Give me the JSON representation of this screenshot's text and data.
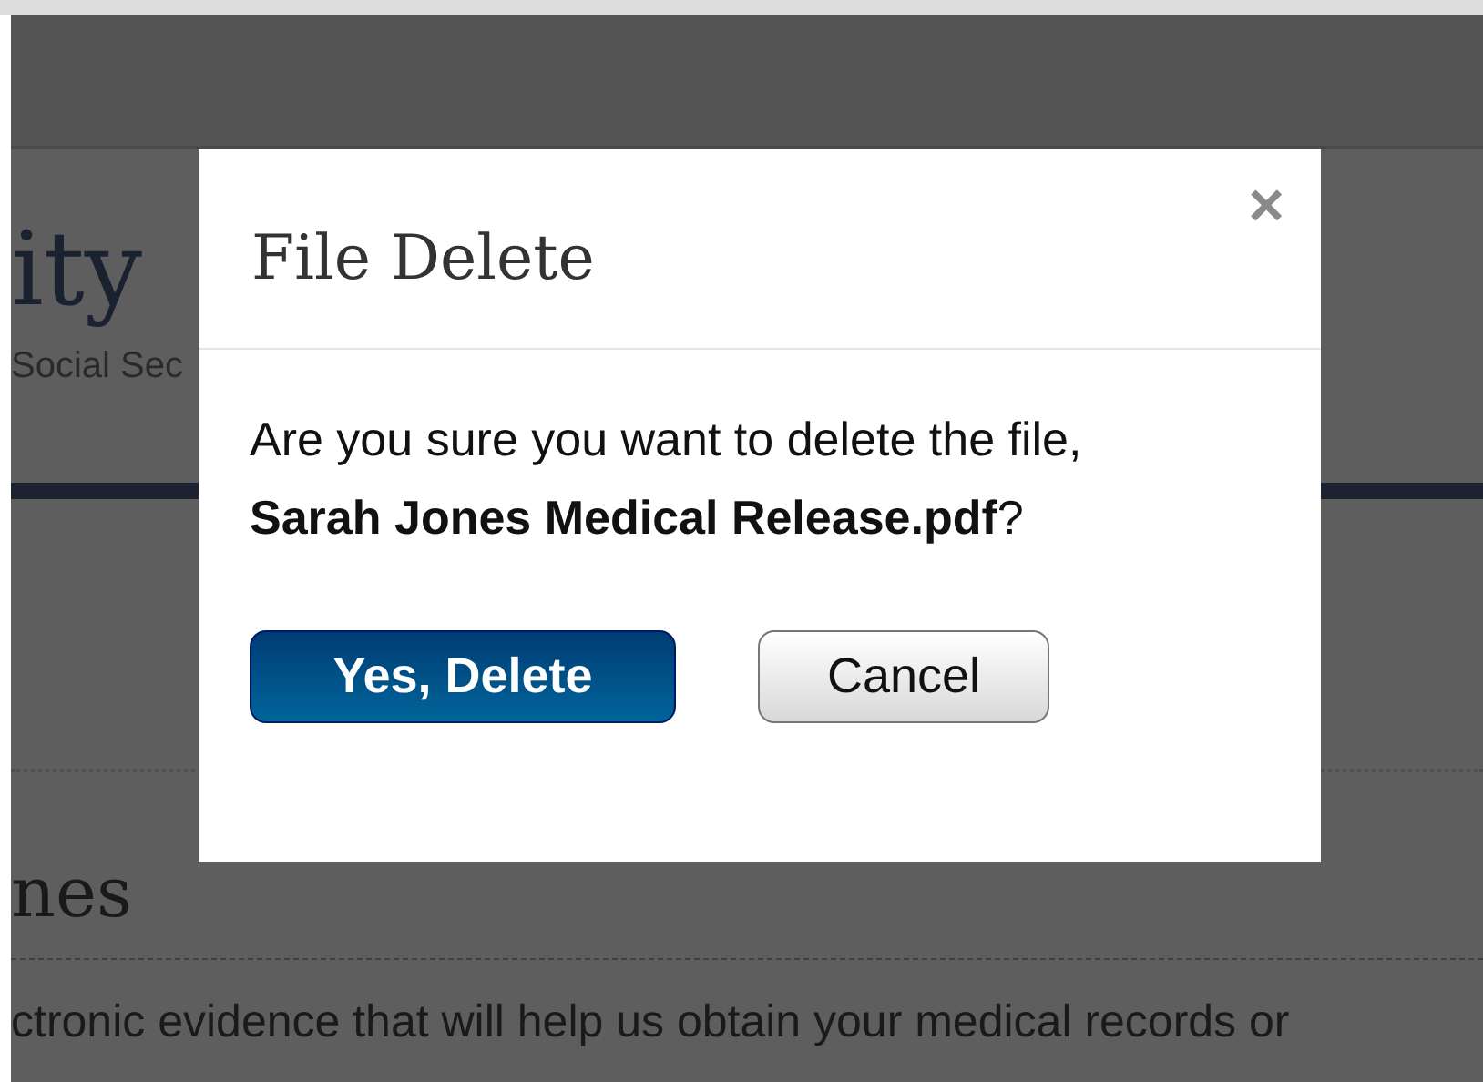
{
  "page": {
    "title_fragment": "ity",
    "subtitle_fragment": "Social Sec",
    "heading_fragment": "nes",
    "text_fragment": "ctronic evidence that will help us obtain your medical records or"
  },
  "dialog": {
    "title": "File Delete",
    "close": "×",
    "message": "Are you sure you want to delete the file, **Sarah Jones Medical Release.pdf**?",
    "buttons": [
      {
        "label": "Yes, Delete",
        "kind": "primary"
      },
      {
        "label": "Cancel",
        "kind": "secondary"
      }
    ]
  }
}
